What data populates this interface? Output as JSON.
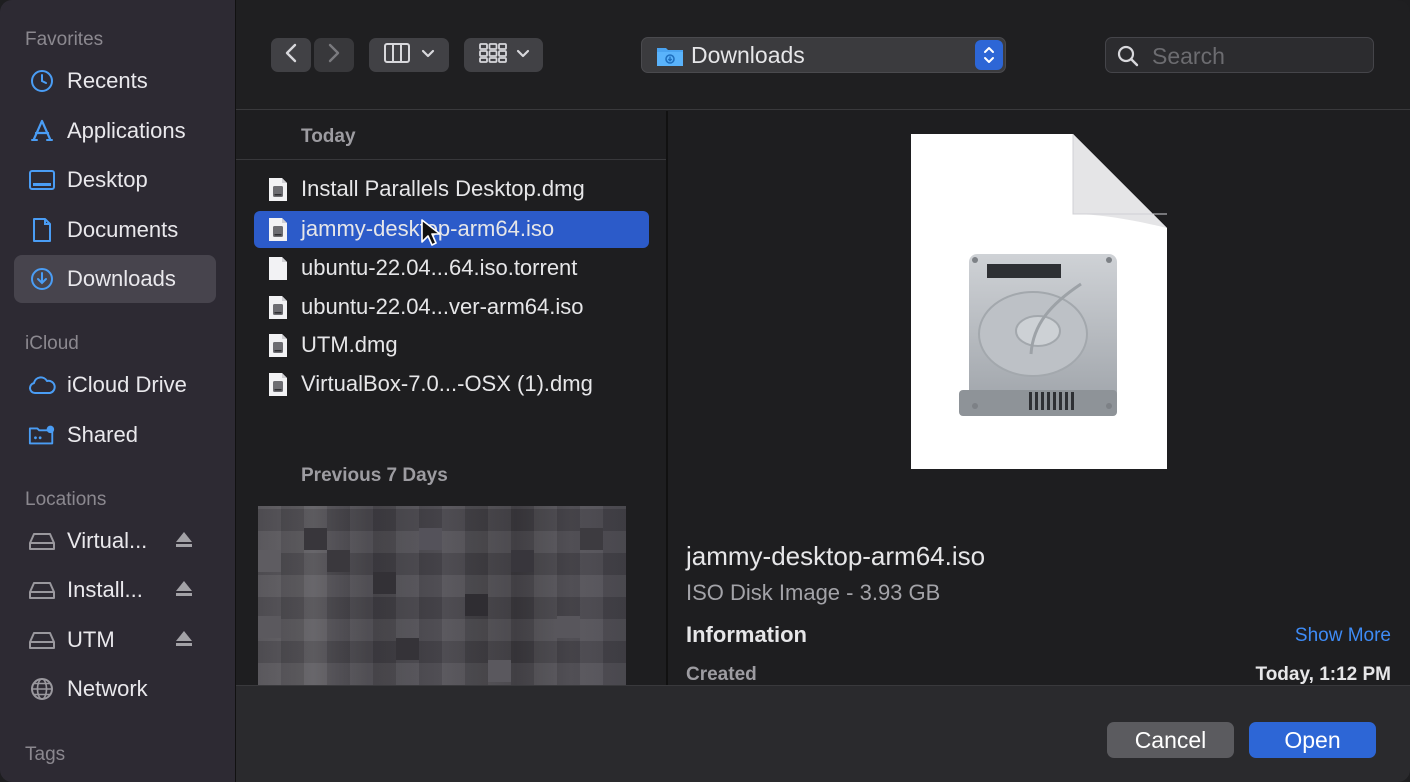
{
  "sidebar": {
    "favorites_header": "Favorites",
    "favorites": [
      {
        "label": "Recents",
        "icon": "clock-icon"
      },
      {
        "label": "Applications",
        "icon": "applications-icon"
      },
      {
        "label": "Desktop",
        "icon": "desktop-icon"
      },
      {
        "label": "Documents",
        "icon": "document-icon"
      },
      {
        "label": "Downloads",
        "icon": "downloads-icon",
        "selected": true
      }
    ],
    "icloud_header": "iCloud",
    "icloud": [
      {
        "label": "iCloud Drive",
        "icon": "cloud-icon"
      },
      {
        "label": "Shared",
        "icon": "shared-folder-icon"
      }
    ],
    "locations_header": "Locations",
    "locations": [
      {
        "label": "Virtual...",
        "icon": "drive-icon",
        "ejectable": true
      },
      {
        "label": "Install...",
        "icon": "drive-icon",
        "ejectable": true
      },
      {
        "label": "UTM",
        "icon": "drive-icon",
        "ejectable": true
      },
      {
        "label": "Network",
        "icon": "globe-icon"
      }
    ],
    "tags_header": "Tags"
  },
  "toolbar": {
    "current_folder": "Downloads",
    "search_placeholder": "Search"
  },
  "file_list": {
    "today_header": "Today",
    "today_files": [
      {
        "name": "Install Parallels Desktop.dmg",
        "selected": false
      },
      {
        "name": "jammy-desktop-arm64.iso",
        "selected": true
      },
      {
        "name": "ubuntu-22.04...64.iso.torrent",
        "selected": false
      },
      {
        "name": "ubuntu-22.04...ver-arm64.iso",
        "selected": false
      },
      {
        "name": "UTM.dmg",
        "selected": false
      },
      {
        "name": "VirtualBox-7.0...-OSX (1).dmg",
        "selected": false
      }
    ],
    "previous_header": "Previous 7 Days"
  },
  "preview": {
    "filename": "jammy-desktop-arm64.iso",
    "kind": "ISO Disk Image - 3.93 GB",
    "information_label": "Information",
    "show_more": "Show More",
    "created_label": "Created",
    "created_value": "Today, 1:12 PM"
  },
  "buttons": {
    "cancel": "Cancel",
    "open": "Open"
  },
  "colors": {
    "accent": "#2d66d6",
    "selection": "#2c5bc9",
    "sidebar_icon": "#4a9df5",
    "link": "#3e8bf5"
  }
}
